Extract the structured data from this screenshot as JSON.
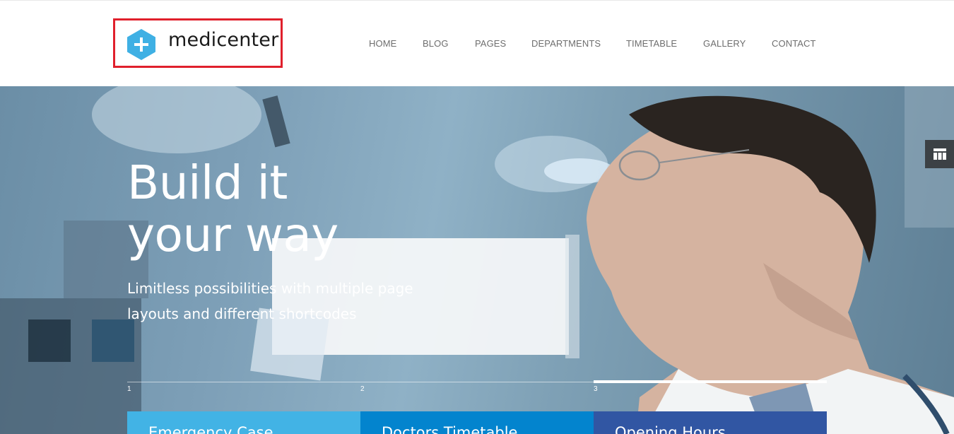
{
  "brand": {
    "name": "medicenter",
    "colors": {
      "logo_hex": "#3fb0e4",
      "highlight_border": "#e0202c"
    },
    "icon": "medical-cross-hexagon-icon"
  },
  "nav": {
    "items": [
      {
        "label": "HOME"
      },
      {
        "label": "BLOG"
      },
      {
        "label": "PAGES"
      },
      {
        "label": "DEPARTMENTS"
      },
      {
        "label": "TIMETABLE"
      },
      {
        "label": "GALLERY"
      },
      {
        "label": "CONTACT"
      }
    ]
  },
  "hero": {
    "title_line1": "Build it",
    "title_line2": "your way",
    "subtitle": "Limitless possibilities with multiple page layouts and different shortcodes",
    "slides": [
      "1",
      "2",
      "3"
    ],
    "active_slide": 3,
    "side_tab_icon": "layout-grid-icon"
  },
  "info_boxes": [
    {
      "title": "Emergency Case",
      "color": "#42b3e5"
    },
    {
      "title": "Doctors Timetable",
      "color": "#0384ce"
    },
    {
      "title": "Opening Hours",
      "color": "#3156a3"
    }
  ]
}
